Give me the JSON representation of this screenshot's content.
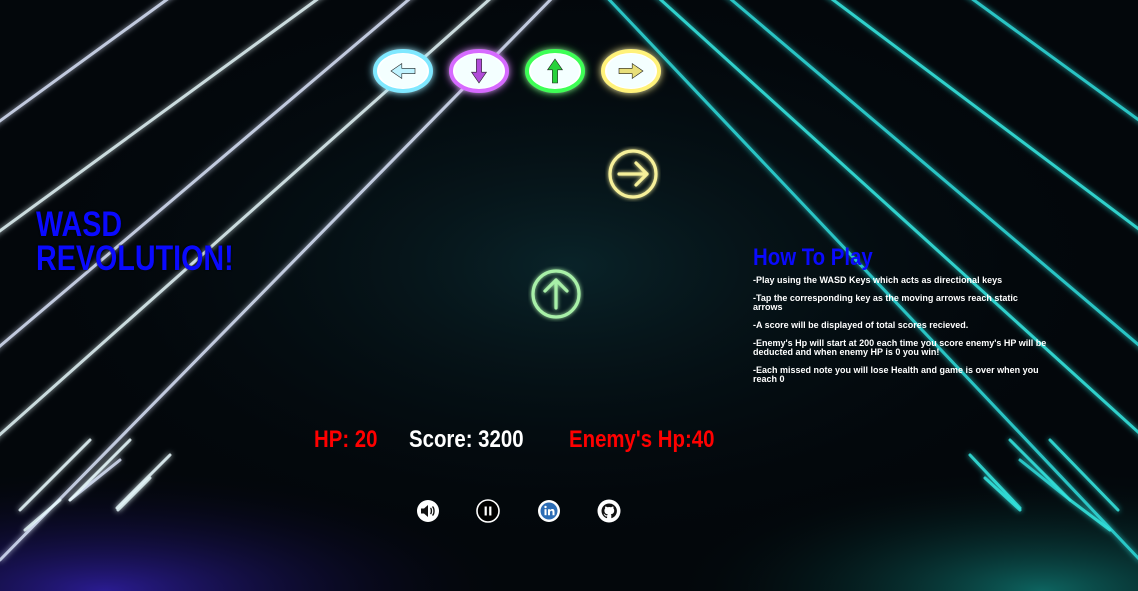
{
  "game": {
    "title_line1": "WASD",
    "title_line2": "REVOLUTION!"
  },
  "how_to_play": {
    "heading": "How To Play",
    "rules": [
      "-Play using the WASD Keys which acts as directional keys",
      "-Tap the corresponding key as the moving arrows reach static arrows",
      "-A score will be displayed of total scores recieved.",
      "-Enemy's Hp will start at 200 each time you score enemy's HP will be deducted and when enemy HP is 0 you win!",
      "-Each missed note you will lose Health and game is over when you reach 0"
    ]
  },
  "stats": {
    "hp": "HP: 20",
    "score": "Score: 3200",
    "enemy_hp": "Enemy's Hp:40"
  },
  "receptors": [
    {
      "direction": "left",
      "color": "#bff3ff",
      "glow": "#7fe8ff",
      "icon": "arrow-left-icon"
    },
    {
      "direction": "down",
      "color": "#b04cd8",
      "glow": "#d66bff",
      "icon": "arrow-down-icon"
    },
    {
      "direction": "up",
      "color": "#27d23a",
      "glow": "#3dff55",
      "icon": "arrow-up-icon"
    },
    {
      "direction": "right",
      "color": "#e8df7a",
      "glow": "#fff27a",
      "icon": "arrow-right-icon"
    }
  ],
  "moving_notes": [
    {
      "direction": "right",
      "color": "#f6f09a",
      "icon": "arrow-right-circle-icon"
    },
    {
      "direction": "up",
      "color": "#a8f0a8",
      "icon": "arrow-up-circle-icon"
    }
  ],
  "controls": [
    {
      "name": "sound-button",
      "icon": "speaker-icon"
    },
    {
      "name": "pause-button",
      "icon": "pause-icon"
    },
    {
      "name": "linkedin-button",
      "icon": "linkedin-icon"
    },
    {
      "name": "github-button",
      "icon": "github-icon"
    }
  ],
  "colors": {
    "title_blue": "#0a0aff",
    "hp_red": "#ff0000",
    "neon_cyan": "#34e6e0",
    "neon_white": "#eafcff"
  }
}
